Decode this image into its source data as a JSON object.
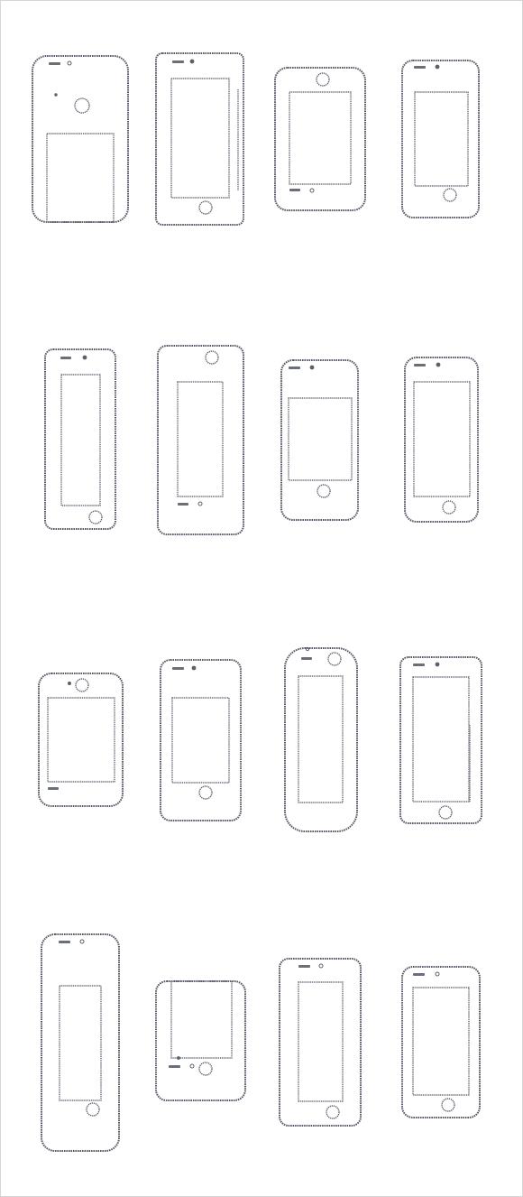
{
  "sheet": {
    "background": "#ffffff",
    "line_color": "#565a66",
    "mockup_count": 16,
    "icons": [
      "phone-outline-icon",
      "home-button-icon",
      "camera-icon"
    ]
  }
}
